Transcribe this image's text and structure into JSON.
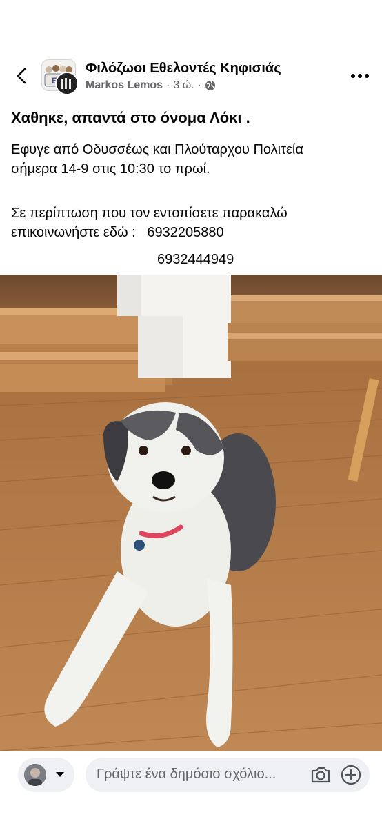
{
  "header": {
    "group_name": "Φιλόζωοι Εθελοντές Κηφισιάς",
    "author": "Markos Lemos",
    "separator": "·",
    "time": "3 ώ.",
    "separator2": "·",
    "group_logo_text": "ΕΛ"
  },
  "post": {
    "title": "Χαθηκε, απαντά στο όνομα Λόκι .",
    "paragraph1_line1": "Εφυγε από Οδυσσέως και Πλούταρχου Πολιτεία",
    "paragraph1_line2": "σήμερα 14-9 στις 10:30 το πρωί.",
    "paragraph2_line1": "Σε περίπτωση που τον εντοπίσετε παρακαλώ",
    "paragraph2_line2": "επικοινωνήστε εδώ :   6932205880",
    "phone2": "6932444949"
  },
  "comment_bar": {
    "placeholder": "Γράψτε ένα δημόσιο σχόλιο..."
  },
  "icons": {
    "back": "chevron-left-icon",
    "more": "more-dots-icon",
    "globe": "globe-icon",
    "camera": "camera-icon",
    "add": "plus-circle-icon",
    "caret": "caret-down-icon"
  },
  "colors": {
    "text": "#050505",
    "secondary": "#65676b",
    "input_bg": "#eef0f3"
  }
}
